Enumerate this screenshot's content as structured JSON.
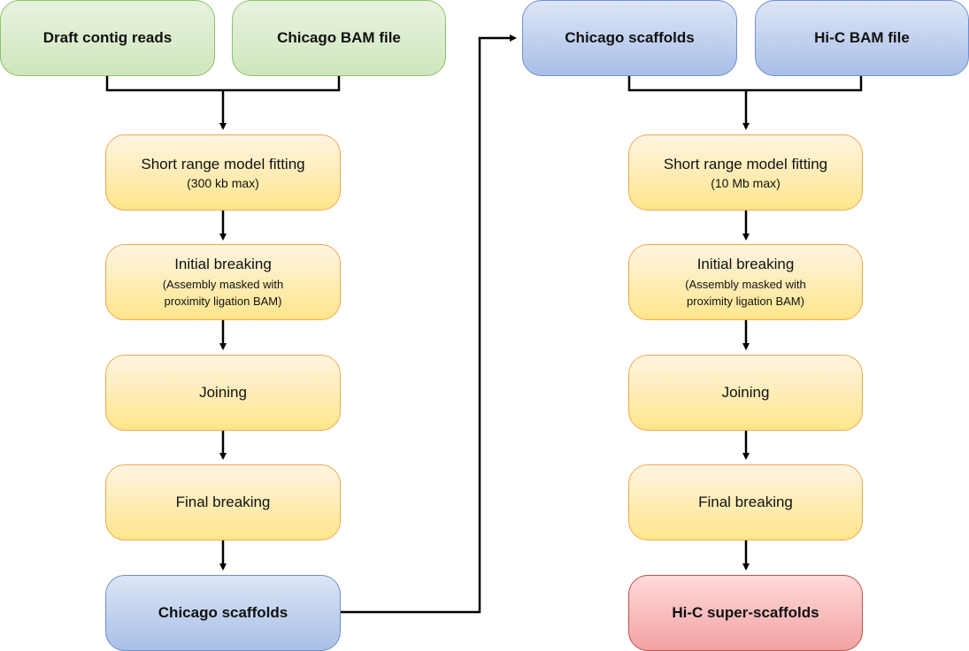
{
  "left_pipeline": {
    "inputs": [
      "Draft contig reads",
      "Chicago BAM file"
    ],
    "steps": [
      {
        "title": "Short range  model fitting",
        "detail": "(300 kb max)"
      },
      {
        "title": "Initial breaking",
        "detail": "(Assembly masked with",
        "detail2": "proximity ligation BAM)"
      },
      {
        "title": "Joining"
      },
      {
        "title": "Final breaking"
      }
    ],
    "output": "Chicago scaffolds"
  },
  "right_pipeline": {
    "inputs": [
      "Chicago scaffolds",
      "Hi-C BAM file"
    ],
    "steps": [
      {
        "title": "Short range  model fitting",
        "detail": "(10 Mb max)"
      },
      {
        "title": "Initial breaking",
        "detail": "(Assembly masked with",
        "detail2": "proximity ligation BAM)"
      },
      {
        "title": "Joining"
      },
      {
        "title": "Final breaking"
      }
    ],
    "output": "Hi-C super-scaffolds"
  },
  "colors": {
    "input_green": "#d8ecc9",
    "process_yellow": "#fff0b0",
    "scaffold_blue": "#c3d3ef",
    "final_red": "#f8bcbc"
  }
}
